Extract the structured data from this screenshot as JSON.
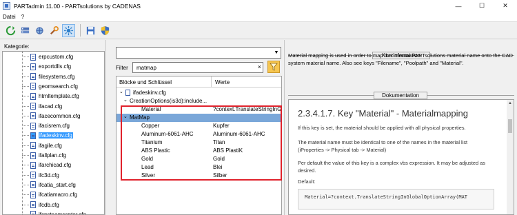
{
  "window": {
    "title": "PARTadmin 11.00 - PARTsolutions by CADENAS",
    "minimize": "—",
    "maximize": "☐",
    "close": "✕"
  },
  "menu": [
    "Datei",
    "?"
  ],
  "toolbar": {
    "icons": [
      "refresh-icon",
      "server-icon",
      "network-icon",
      "tools-icon",
      "settings-icon",
      "save-icon",
      "shield-icon"
    ]
  },
  "left": {
    "label": "Kategorie:",
    "files": [
      "erpcustom.cfg",
      "exportdlls.cfg",
      "filesystems.cfg",
      "geomsearch.cfg",
      "htmltemplate.cfg",
      "ifacad.cfg",
      "ifacecommon.cfg",
      "ifacisrem.cfg",
      "ifadeskinv.cfg",
      "ifagile.cfg",
      "ifallplan.cfg",
      "ifarchicad.cfg",
      "ifc3d.cfg",
      "ifcatia_start.cfg",
      "ifcatiamacro.cfg",
      "ifcdb.cfg",
      "ifcnsteamcenter.cfg"
    ],
    "selected_index": 8
  },
  "middle": {
    "combo_value": "",
    "filter_label": "Filter",
    "filter_value": "matmap",
    "filter_clear": "×",
    "col_keys": "Blöcke und Schlüssel",
    "col_values": "Werte",
    "tree": {
      "root_file": "ifadeskinv.cfg",
      "block1": "CreationOptions(is3d):include...",
      "key_material": "Material",
      "val_material": "?context.TranslateStringInGl",
      "block2": "MatMap"
    },
    "matmap": [
      {
        "key": "Copper",
        "value": "Kupfer"
      },
      {
        "key": "Aluminum-6061-AHC",
        "value": "Aluminum-6061-AHC"
      },
      {
        "key": "Titanium",
        "value": "Titan"
      },
      {
        "key": "ABS Plastic",
        "value": "ABS PlastiK"
      },
      {
        "key": "Gold",
        "value": "Gold"
      },
      {
        "key": "Lead",
        "value": "Blei"
      },
      {
        "key": "Silver",
        "value": "Silber"
      }
    ]
  },
  "right": {
    "kurz_title": "Kurzinformation",
    "kurz_text": "Material mapping is used in order to map the internal PARTsolutions material name onto the CAD system material name. Also see keys \"Filename\", \"Poolpath\" and \"Material\".",
    "doc_title": "Dokumentation",
    "doc_heading": "2.3.4.1.7. Key \"Material\" - Materialmapping",
    "doc_p1": "If this key is set, the material should be applied with all physical properties.",
    "doc_p2": "The material name must be identical to one of the names in the material list (iProperties -> Physical tab -> Material)",
    "doc_p3": "Per default the value of this key is a complex vbs expression. It may be adjusted as desired.",
    "doc_default": "Default:",
    "doc_code": "Material=?context.TranslateStringInGlobalOptionArray(MAT"
  },
  "colors": {
    "selection": "#3399ff",
    "row_highlight": "#7aa7d9",
    "red_frame": "#e0212b",
    "filter_button": "#f6c650"
  }
}
